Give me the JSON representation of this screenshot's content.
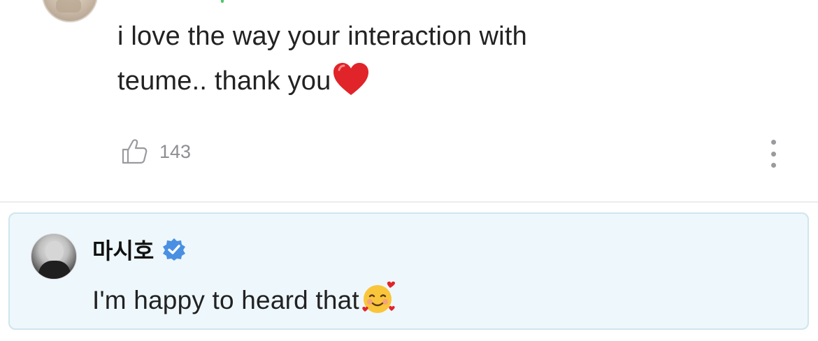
{
  "comment": {
    "text_line1": "i love the way your interaction with",
    "text_line2": "teume.. thank you",
    "trailing_emoji": "red-heart",
    "like_count": "143"
  },
  "reply": {
    "author": "마시호",
    "verified": true,
    "text": "I'm happy to heard that",
    "trailing_emoji": "smiling-face-with-hearts"
  },
  "colors": {
    "reply_background": "#eef7fb",
    "reply_border": "#cfe5ee",
    "verified_badge": "#4a90e2",
    "muted_text": "#8e8e93",
    "heart": "#e0242a"
  }
}
